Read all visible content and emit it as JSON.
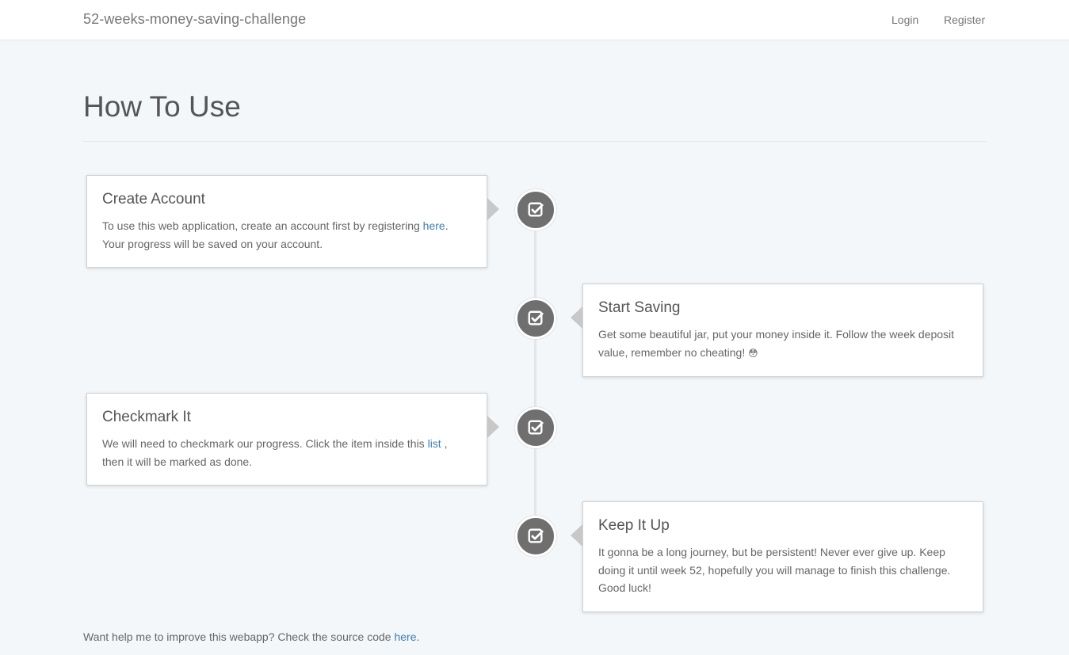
{
  "navbar": {
    "brand": "52-weeks-money-saving-challenge",
    "login": "Login",
    "register": "Register"
  },
  "header": {
    "title": "How To Use"
  },
  "steps": [
    {
      "title": "Create Account",
      "text_before": "To use this web application, create an account first by registering ",
      "link": "here",
      "text_after": ". Your progress will be saved on your account.",
      "icon": "check-square-icon"
    },
    {
      "title": "Start Saving",
      "text_before": "Get some beautiful jar, put your money inside it. Follow the week deposit value, remember no cheating! ",
      "emoji": "😳",
      "icon": "check-square-icon"
    },
    {
      "title": "Checkmark It",
      "text_before": "We will need to checkmark our progress. Click the item inside this ",
      "link": "list",
      "text_after": " , then it will be marked as done.",
      "icon": "check-square-icon"
    },
    {
      "title": "Keep It Up",
      "text_before": "It gonna be a long journey, but be persistent! Never ever give up. Keep doing it until week 52, hopefully you will manage to finish this challenge. Good luck!",
      "icon": "check-square-icon"
    }
  ],
  "footer": {
    "text_before": "Want help me to improve this webapp? Check the source code ",
    "link": "here",
    "text_after": "."
  },
  "colors": {
    "background": "#f4f7f9",
    "badge": "#6f6f6f",
    "link": "#3a7fb5"
  }
}
